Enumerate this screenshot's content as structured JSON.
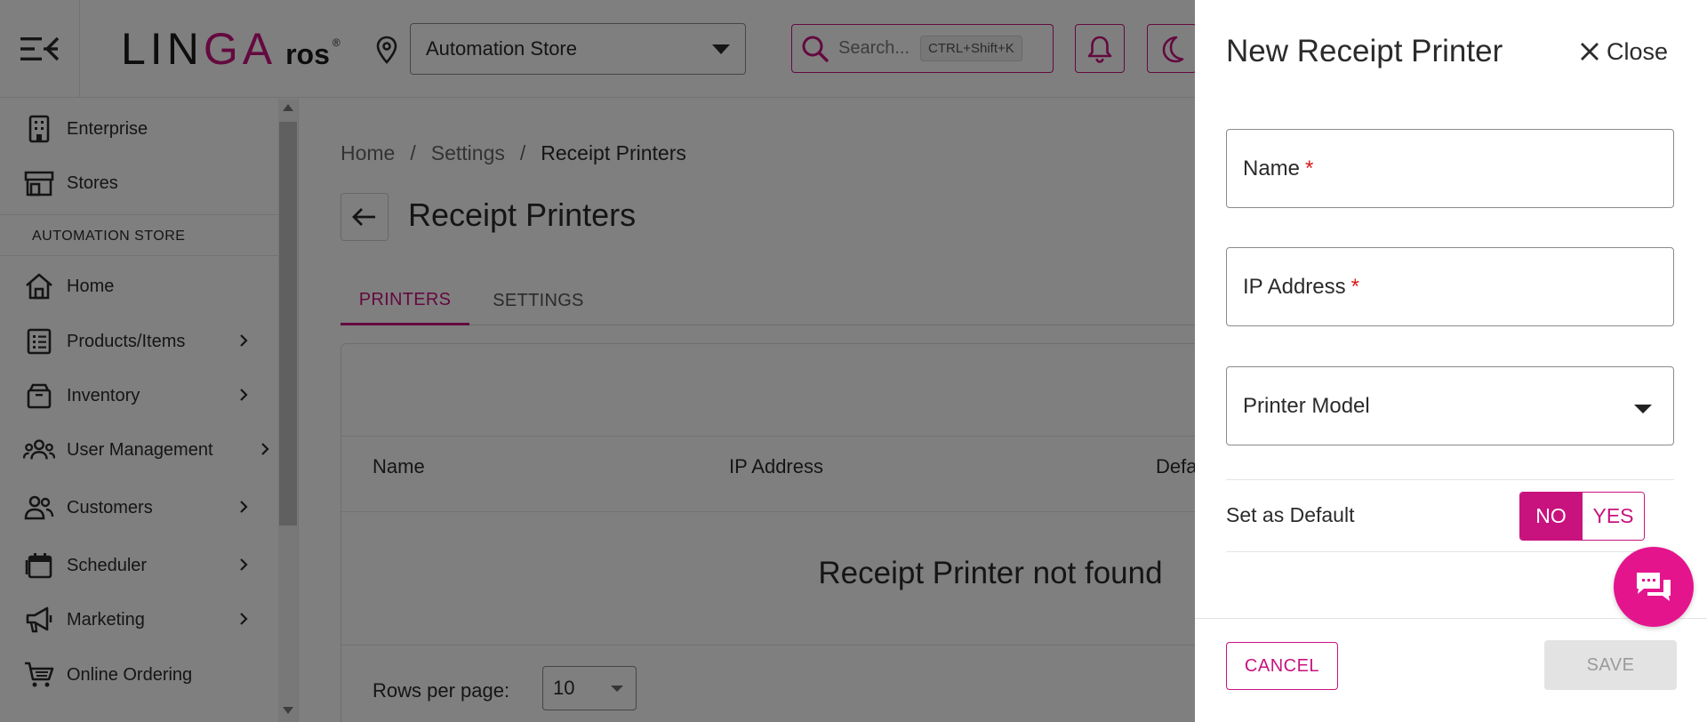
{
  "header": {
    "logo_main_a": "LIN",
    "logo_main_b": "GA",
    "logo_suffix": "ros",
    "logo_reg": "®",
    "store_select_value": "Automation Store",
    "search_placeholder": "Search...",
    "search_shortcut": "CTRL+Shift+K"
  },
  "sidebar": {
    "section_title": "AUTOMATION STORE",
    "items": [
      {
        "label": "Enterprise",
        "icon": "building-icon"
      },
      {
        "label": "Stores",
        "icon": "storefront-icon"
      },
      {
        "label": "Home",
        "icon": "home-icon"
      },
      {
        "label": "Products/Items",
        "icon": "list-icon"
      },
      {
        "label": "Inventory",
        "icon": "box-icon"
      },
      {
        "label": "User Management",
        "icon": "users-icon"
      },
      {
        "label": "Customers",
        "icon": "customers-icon"
      },
      {
        "label": "Scheduler",
        "icon": "calendar-icon"
      },
      {
        "label": "Marketing",
        "icon": "megaphone-icon"
      },
      {
        "label": "Online Ordering",
        "icon": "cart-icon"
      }
    ]
  },
  "main": {
    "breadcrumb": [
      "Home",
      "Settings",
      "Receipt Printers"
    ],
    "breadcrumb_sep": "/",
    "title": "Receipt Printers",
    "tabs": [
      "PRINTERS",
      "SETTINGS"
    ],
    "columns": [
      "Name",
      "IP Address",
      "Defa"
    ],
    "empty_message": "Receipt Printer not found",
    "rows_per_page_label": "Rows per page:",
    "rows_per_page_value": "10"
  },
  "drawer": {
    "title": "New Receipt Printer",
    "close_label": "Close",
    "name_label": "Name",
    "ip_label": "IP Address",
    "required_mark": "*",
    "model_label": "Printer Model",
    "default_label": "Set as Default",
    "toggle_no": "NO",
    "toggle_yes": "YES",
    "cancel_label": "CANCEL",
    "save_label": "SAVE"
  },
  "colors": {
    "accent": "#c8137f",
    "chat_bubble": "#e4148d",
    "overlay": "rgba(0,0,0,0.5)",
    "required": "#d81b1b"
  }
}
